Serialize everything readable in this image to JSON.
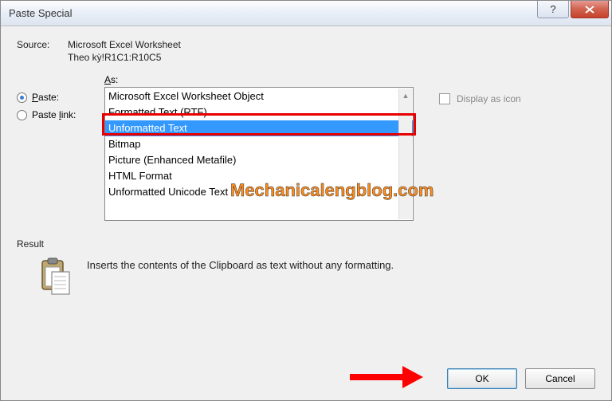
{
  "titlebar": {
    "title": "Paste Special"
  },
  "source": {
    "label": "Source:",
    "line1": "Microsoft Excel Worksheet",
    "line2": "Theo kỳ!R1C1:R10C5"
  },
  "radio": {
    "paste": "Paste:",
    "paste_link": "Paste link:"
  },
  "list": {
    "label": "As:",
    "items": [
      "Microsoft Excel Worksheet Object",
      "Formatted Text (RTF)",
      "Unformatted Text",
      "Bitmap",
      "Picture (Enhanced Metafile)",
      "HTML Format",
      "Unformatted Unicode Text"
    ]
  },
  "display_as_icon": {
    "label": "Display as icon"
  },
  "result": {
    "label": "Result",
    "text": "Inserts the contents of the Clipboard as text without any formatting."
  },
  "buttons": {
    "ok": "OK",
    "cancel": "Cancel"
  },
  "watermark": "Mechanicalengblog.com"
}
